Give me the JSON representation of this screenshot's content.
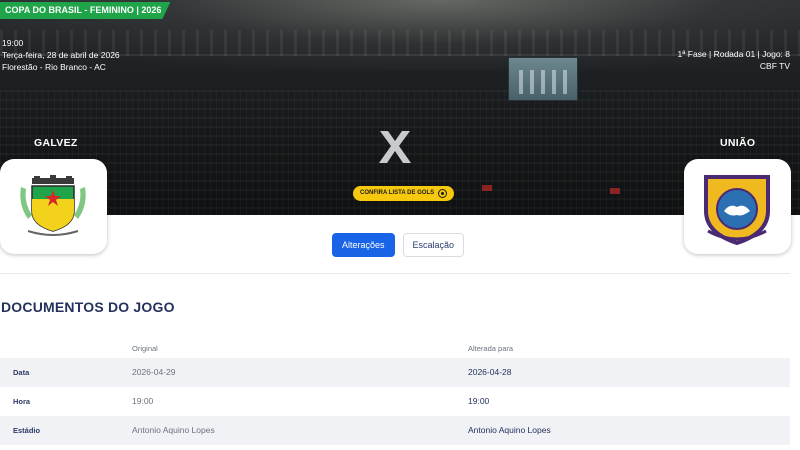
{
  "competition": "COPA DO BRASIL - FEMININO | 2026",
  "match": {
    "time": "19:00",
    "date": "Terça-feira, 28 de abril de 2026",
    "venue": "Florestão - Rio Branco - AC",
    "phase_info": "1ª Fase | Rodada 01 | Jogo: 8",
    "broadcast": "CBF TV"
  },
  "home_team": {
    "name": "GALVEZ",
    "crest_icon": "galvez-crest-icon"
  },
  "away_team": {
    "name": "UNIÃO",
    "crest_icon": "uniao-crest-icon"
  },
  "versus": "X",
  "goals_button": "CONFIRA LISTA DE GOLS",
  "tabs": [
    {
      "label": "Alterações",
      "active": true
    },
    {
      "label": "Escalação",
      "active": false
    }
  ],
  "documents": {
    "title": "DOCUMENTOS DO JOGO",
    "columns": {
      "original": "Original",
      "changed": "Alterada para"
    },
    "rows": [
      {
        "field": "Data",
        "original": "2026-04-29",
        "changed": "2026-04-28"
      },
      {
        "field": "Hora",
        "original": "19:00",
        "changed": "19:00"
      },
      {
        "field": "Estádio",
        "original": "Antonio Aquino Lopes",
        "changed": "Antonio Aquino Lopes"
      }
    ]
  },
  "colors": {
    "badge_green": "#1fa44a",
    "primary_blue": "#1863e6",
    "gold": "#f6c90e",
    "title_navy": "#24325d"
  }
}
